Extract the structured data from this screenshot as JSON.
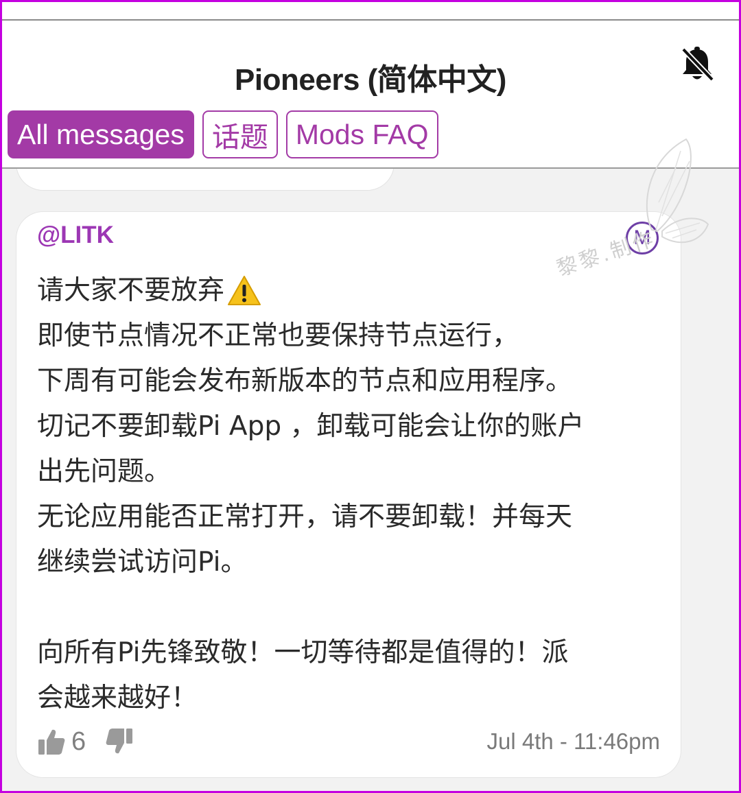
{
  "header": {
    "title": "Pioneers (简体中文)",
    "bell_icon": "bell-off-icon"
  },
  "tabs": [
    {
      "label": "All messages",
      "active": true
    },
    {
      "label": "话题",
      "active": false
    },
    {
      "label": "Mods FAQ",
      "active": false
    }
  ],
  "message": {
    "author": "@LITK",
    "badge": "M",
    "lines": [
      "请大家不要放弃",
      "即使节点情况不正常也要保持节点运行，",
      "下周有可能会发布新版本的节点和应用程序。",
      "切记不要卸载Pi App ，卸载可能会让你的账户",
      "出先问题。",
      "无论应用能否正常打开，请不要卸载！并每天",
      "继续尝试访问Pi。",
      "",
      "向所有Pi先锋致敬！一切等待都是值得的！派",
      "会越来越好！"
    ],
    "warning_icon": "warning-icon",
    "likes": "6",
    "timestamp": "Jul 4th - 11:46pm"
  },
  "watermark": {
    "text": "黎黎.制作"
  },
  "colors": {
    "accent": "#a33aa6",
    "author": "#9c37b4",
    "frame": "#c400e0",
    "background": "#f2f2f2"
  }
}
